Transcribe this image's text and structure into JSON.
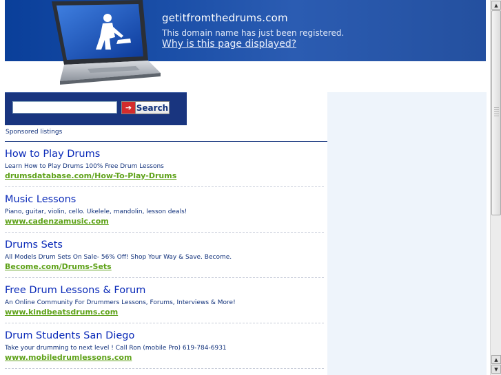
{
  "header": {
    "domain": "getitfromthedrums.com",
    "registered_text": "This domain name has just been registered.",
    "why_link": "Why is this page displayed?"
  },
  "search": {
    "value": "",
    "placeholder": "",
    "button_label": "Search"
  },
  "sponsored_label": "Sponsored listings",
  "listings": [
    {
      "title": "How to Play Drums",
      "description": "Learn How to Play Drums 100% Free Drum Lessons",
      "url": "drumsdatabase.com/How-To-Play-Drums"
    },
    {
      "title": "Music Lessons",
      "description": "Piano, guitar, violin, cello. Ukelele, mandolin, lesson deals!",
      "url": "www.cadenzamusic.com"
    },
    {
      "title": "Drums Sets",
      "description": "All Models Drum Sets On Sale- 56% Off! Shop Your Way & Save. Become.",
      "url": "Become.com/Drums-Sets"
    },
    {
      "title": "Free Drum Lessons & Forum",
      "description": "An Online Community For Drummers Lessons, Forums, Interviews & More!",
      "url": "www.kindbeatsdrums.com"
    },
    {
      "title": "Drum Students San Diego",
      "description": "Take your drumming to next level ! Call Ron (mobile Pro) 619-784-6931",
      "url": "www.mobiledrumlessons.com"
    }
  ],
  "icons": {
    "laptop": "laptop-construction-icon",
    "search_arrow": "arrow-right-icon"
  },
  "colors": {
    "header_blue": "#1b4fa8",
    "search_box_blue": "#19357f",
    "title_blue": "#0a2ab8",
    "url_green": "#5fa21a",
    "search_red": "#d42c2c",
    "right_panel": "#eef4fb"
  }
}
